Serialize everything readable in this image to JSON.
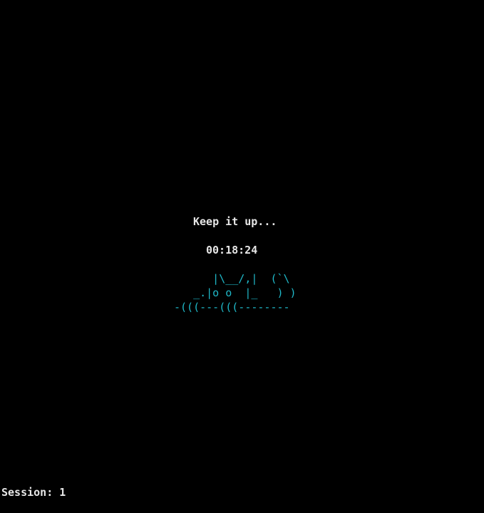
{
  "message": "Keep it up...",
  "timer": "00:18:24",
  "ascii_art": "      |\\__/,|  (`\\\n   _.|o o  |_   ) )\n-(((---(((--------",
  "status": {
    "session_label": "Session: 1"
  },
  "colors": {
    "background": "#000000",
    "text": "#e6e6e6",
    "art": "#1fb8c8"
  }
}
